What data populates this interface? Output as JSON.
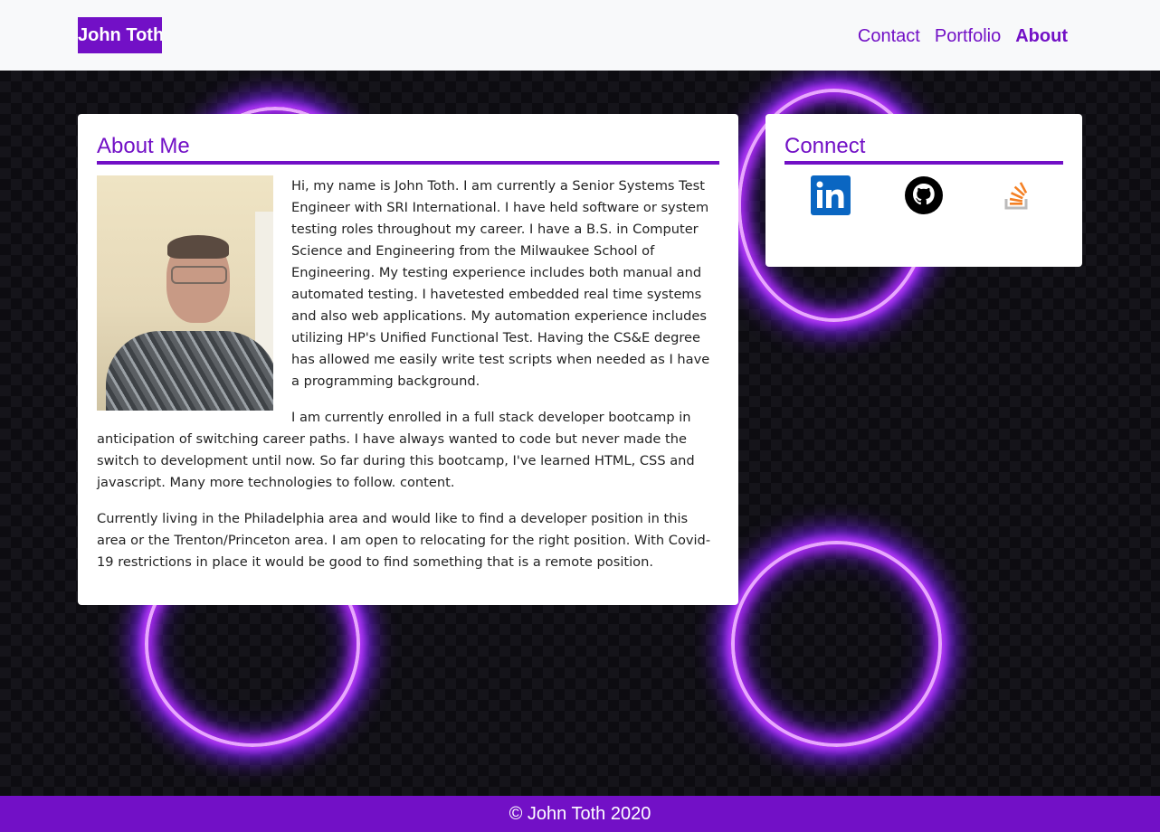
{
  "navbar": {
    "brand": "John Toth",
    "links": [
      {
        "label": "Contact",
        "active": false
      },
      {
        "label": "Portfolio",
        "active": false
      },
      {
        "label": "About",
        "active": true
      }
    ]
  },
  "about": {
    "heading": "About Me",
    "paragraphs": [
      "Hi, my name is John Toth. I am currently a Senior Systems Test Engineer with SRI International. I have held software or system testing roles throughout my career. I have a B.S. in Computer Science and Engineering from the Milwaukee School of Engineering. My testing experience includes both manual and automated testing. I havetested embedded real time systems and also web applications. My automation experience includes utilizing HP's Unified Functional Test. Having the CS&E degree has allowed me easily write test scripts when needed as I have a programming background.",
      "I am currently enrolled in a full stack developer bootcamp in anticipation of switching career paths. I have always wanted to code but never made the switch to development until now. So far during this bootcamp, I've learned HTML, CSS and javascript. Many more technologies to follow. content.",
      "Currently living in the Philadelphia area and would like to find a developer position in this area or the Trenton/Princeton area. I am open to relocating for the right position. With Covid-19 restrictions in place it would be good to find something that is a remote position."
    ]
  },
  "connect": {
    "heading": "Connect",
    "links": [
      {
        "icon": "linkedin-icon",
        "color": "#0a66c2"
      },
      {
        "icon": "github-icon",
        "color": "#000000"
      },
      {
        "icon": "stackoverflow-icon",
        "color": "#f48024"
      }
    ]
  },
  "footer": {
    "text": "© John Toth 2020"
  },
  "colors": {
    "brand": "#7210c6",
    "navbar_bg": "#f8f9fa",
    "glow": "#c23cff"
  }
}
